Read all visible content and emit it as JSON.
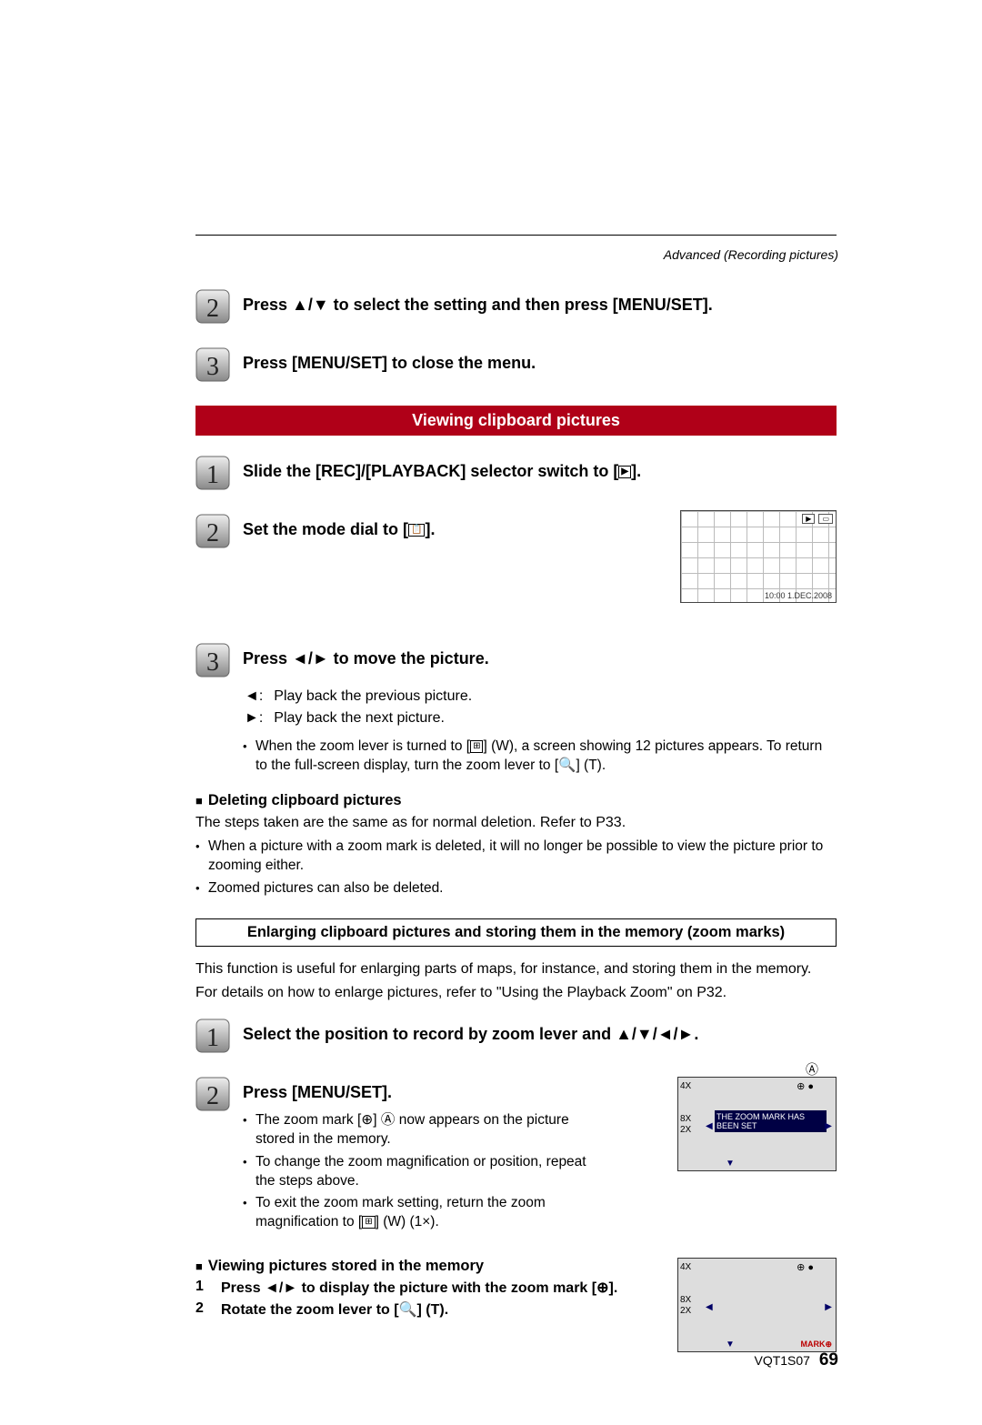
{
  "header": {
    "section": "Advanced (Recording pictures)"
  },
  "topSteps": {
    "s2": "Press ▲/▼ to select the setting and then press [MENU/SET].",
    "s3": "Press [MENU/SET] to close the menu."
  },
  "redBar1": "Viewing clipboard pictures",
  "viewSteps": {
    "s1": "Slide the [REC]/[PLAYBACK] selector switch to [",
    "s1_end": "].",
    "s2": "Set the mode dial to [",
    "s2_end": "].",
    "s3": "Press ◄/► to move the picture."
  },
  "lcd1": {
    "play_icon": "▶",
    "battery": "▭",
    "timestamp": "10:00   1.DEC.2008"
  },
  "arrowDefs": {
    "left": "◄:",
    "left_t": "Play back the previous picture.",
    "right": "►:",
    "right_t": "Play back the next picture."
  },
  "zoomNote": {
    "a": "When the zoom lever is turned to [",
    "a_mid": "] (W), a screen showing 12 pictures appears. To return to the full-screen display, turn the zoom lever to [",
    "a_end": "] (T)."
  },
  "deleting": {
    "title": "Deleting clipboard pictures",
    "body": "The steps taken are the same as for normal deletion. Refer to P33.",
    "b1": "When a picture with a zoom mark is deleted, it will no longer be possible to view the picture prior to zooming either.",
    "b2": "Zoomed pictures can also be deleted."
  },
  "boxTitle": "Enlarging clipboard pictures and storing them in the memory (zoom marks)",
  "enlargeIntro": {
    "p1": "This function is useful for enlarging parts of maps, for instance, and storing them in the memory.",
    "p2": "For details on how to enlarge pictures, refer to \"Using the Playback Zoom\" on P32."
  },
  "enlargeSteps": {
    "s1": "Select the position to record by zoom lever and ▲/▼/◄/►.",
    "s2": "Press [MENU/SET].",
    "s2_n1a": "The zoom mark [",
    "s2_n1b": "] Ⓐ now appears on the picture stored in the memory.",
    "s2_n2": "To change the zoom magnification or position, repeat the steps above.",
    "s2_n3a": "To exit the zoom mark setting, return the zoom magnification to [",
    "s2_n3b": "] (W) (1×)."
  },
  "zoomLcd1": {
    "circA": "Ⓐ",
    "scale": "4X\n\n\n8X\n2X",
    "pin": "⊕ ●",
    "msg": "THE ZOOM MARK HAS BEEN SET"
  },
  "viewingMem": {
    "title": "Viewing pictures stored in the memory",
    "sub1_n": "1",
    "sub1_a": "Press ◄/► to display the picture with the zoom mark [",
    "sub1_b": "].",
    "sub2_n": "2",
    "sub2_a": "Rotate the zoom lever to [",
    "sub2_b": "] (T)."
  },
  "zoomLcd2": {
    "scale": "4X\n\n\n8X\n2X",
    "pin": "⊕ ●",
    "mark": "MARK⊕"
  },
  "icons": {
    "play": "▶",
    "clipboard": "📋",
    "grid": "⊞",
    "mag": "🔍",
    "zoomplus": "⊕"
  },
  "footer": {
    "code": "VQT1S07",
    "page": "69"
  }
}
